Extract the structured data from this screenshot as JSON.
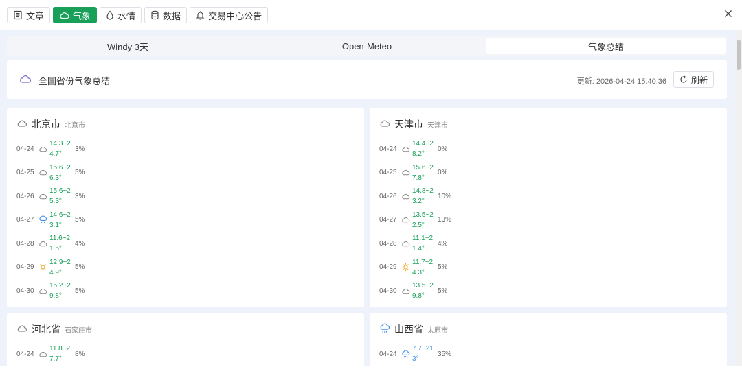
{
  "toolbar": {
    "tabs": [
      {
        "label": "文章",
        "icon": "document-icon"
      },
      {
        "label": "气象",
        "icon": "cloud-icon",
        "active": true
      },
      {
        "label": "水情",
        "icon": "water-drop-icon"
      },
      {
        "label": "数据",
        "icon": "database-icon"
      },
      {
        "label": "交易中心公告",
        "icon": "bell-icon"
      }
    ]
  },
  "segments": [
    {
      "label": "Windy 3天"
    },
    {
      "label": "Open-Meteo"
    },
    {
      "label": "气象总结",
      "active": true
    }
  ],
  "summary": {
    "title": "全国省份气象总结",
    "updated": "更新: 2026-04-24 15:40:36",
    "refresh_label": "刷新"
  },
  "colors": {
    "accent": "#18a058",
    "cloud_purple": "#7b68c9",
    "blue": "#3a8ee6",
    "sun": "#f5a623"
  },
  "cards": [
    {
      "province": "北京市",
      "city": "北京市",
      "icon": "cloud-icon",
      "days": [
        {
          "date": "04-24",
          "icon": "cloud-icon",
          "temp": "14.3~24.7°",
          "pct": "3%"
        },
        {
          "date": "04-25",
          "icon": "cloud-icon",
          "temp": "15.6~26.3°",
          "pct": "5%"
        },
        {
          "date": "04-26",
          "icon": "cloud-icon",
          "temp": "15.6~25.3°",
          "pct": "3%"
        },
        {
          "date": "04-27",
          "icon": "rain-cloud-icon",
          "temp": "14.6~23.1°",
          "pct": "5%"
        },
        {
          "date": "04-28",
          "icon": "cloud-icon",
          "temp": "11.6~21.5°",
          "pct": "4%"
        },
        {
          "date": "04-29",
          "icon": "sun-icon",
          "temp": "12.9~24.9°",
          "pct": "5%"
        },
        {
          "date": "04-30",
          "icon": "cloud-icon",
          "temp": "15.2~29.8°",
          "pct": "5%"
        }
      ]
    },
    {
      "province": "天津市",
      "city": "天津市",
      "icon": "cloud-icon",
      "days": [
        {
          "date": "04-24",
          "icon": "cloud-icon",
          "temp": "14.4~28.2°",
          "pct": "0%"
        },
        {
          "date": "04-25",
          "icon": "cloud-icon",
          "temp": "15.6~27.8°",
          "pct": "0%"
        },
        {
          "date": "04-26",
          "icon": "cloud-icon",
          "temp": "14.8~23.2°",
          "pct": "10%"
        },
        {
          "date": "04-27",
          "icon": "cloud-icon",
          "temp": "13.5~22.5°",
          "pct": "13%"
        },
        {
          "date": "04-28",
          "icon": "cloud-icon",
          "temp": "11.1~21.4°",
          "pct": "4%"
        },
        {
          "date": "04-29",
          "icon": "sun-icon",
          "temp": "11.7~24.3°",
          "pct": "5%"
        },
        {
          "date": "04-30",
          "icon": "cloud-icon",
          "temp": "13.5~29.8°",
          "pct": "5%"
        }
      ]
    },
    {
      "province": "河北省",
      "city": "石家庄市",
      "icon": "cloud-icon",
      "days": [
        {
          "date": "04-24",
          "icon": "cloud-icon",
          "temp": "11.8~27.7°",
          "pct": "8%"
        }
      ]
    },
    {
      "province": "山西省",
      "city": "太原市",
      "icon": "rain-cloud-icon",
      "days": [
        {
          "date": "04-24",
          "icon": "rain-cloud-icon",
          "temp": "7.7~21.3°",
          "pct": "35%",
          "blue": true
        }
      ]
    }
  ]
}
